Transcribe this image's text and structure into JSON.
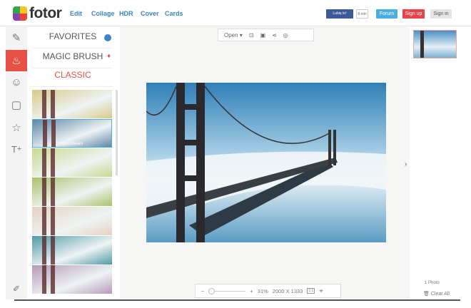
{
  "header": {
    "logo": "fotor",
    "nav": [
      "Edit",
      "Collage",
      "HDR",
      "Cover",
      "Cards"
    ],
    "like_label": "Lubię to!",
    "like_count": "8 mln",
    "forum": "Forum",
    "signup": "Sign up",
    "signin": "Sign in"
  },
  "tools": [
    {
      "icon": "pencil-icon"
    },
    {
      "icon": "paint-bucket-icon",
      "active": true
    },
    {
      "icon": "sticker-icon"
    },
    {
      "icon": "frame-icon"
    },
    {
      "icon": "star-icon"
    },
    {
      "icon": "text-icon"
    },
    {
      "icon": "edit-note-icon"
    }
  ],
  "panel": {
    "favorites": "FAVORITES",
    "magic_brush": "MAGIC BRUSH",
    "classic": "CLASSIC",
    "selected_filter": "Moonbeam"
  },
  "toolbar": {
    "open": "Open"
  },
  "zoom": {
    "minus": "−",
    "plus": "+",
    "percent": "31%",
    "dimensions": "2000 X 1333",
    "actual_size": "1:1"
  },
  "right": {
    "photo_count": "1 Photo",
    "clear_all": "Clear All"
  },
  "colors": {
    "accent": "#e55145",
    "link": "#3a86c4",
    "forum": "#4aaee3",
    "signup": "#e8434a"
  }
}
